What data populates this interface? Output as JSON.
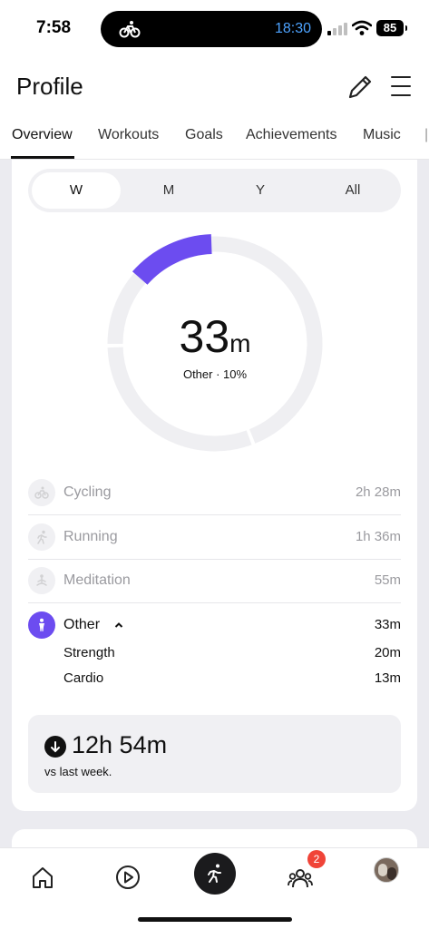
{
  "status_bar": {
    "time": "7:58",
    "live_activity_time": "18:30",
    "battery": "85"
  },
  "header": {
    "title": "Profile",
    "edit_icon": "pencil-icon",
    "menu_icon": "hamburger-menu-icon"
  },
  "tabs": [
    {
      "label": "Overview",
      "active": true
    },
    {
      "label": "Workouts"
    },
    {
      "label": "Goals"
    },
    {
      "label": "Achievements"
    },
    {
      "label": "Music"
    }
  ],
  "period_selector": {
    "options": [
      "W",
      "M",
      "Y",
      "All"
    ],
    "selected": "W"
  },
  "summary": {
    "value": "33",
    "unit": "m",
    "caption": "Other · 10%",
    "highlight_color": "#6c4cf0",
    "highlight_fraction": 0.1
  },
  "activities": [
    {
      "label": "Cycling",
      "value": "2h 28m",
      "icon": "cycling-icon"
    },
    {
      "label": "Running",
      "value": "1h 36m",
      "icon": "running-icon"
    },
    {
      "label": "Meditation",
      "value": "55m",
      "icon": "meditation-icon"
    }
  ],
  "other": {
    "label": "Other",
    "value": "33m",
    "icon": "person-icon",
    "expanded": true,
    "sub_items": [
      {
        "label": "Strength",
        "value": "20m"
      },
      {
        "label": "Cardio",
        "value": "13m"
      }
    ]
  },
  "comparison": {
    "value": "12h 54m",
    "label": "vs last week.",
    "direction": "down"
  },
  "bottom_nav": {
    "items": [
      "home-icon",
      "play-icon",
      "activity-icon",
      "community-icon",
      "avatar"
    ],
    "notification_count": "2"
  }
}
